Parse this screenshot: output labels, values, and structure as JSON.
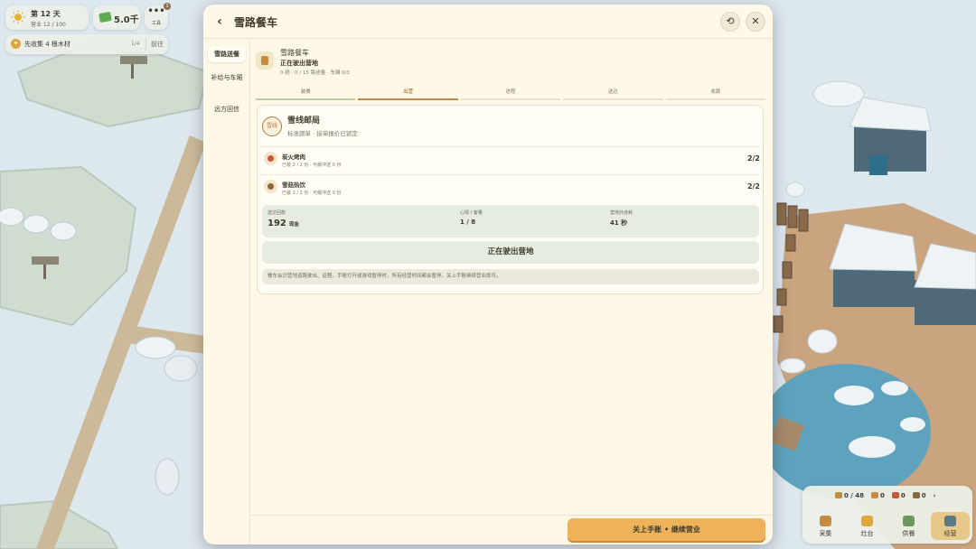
{
  "hud": {
    "day_label": "第 12 天",
    "time_label": "营业 12 / 100",
    "money": "5.0千",
    "tools_label": "工具",
    "tools_badge": "3",
    "tools_dots": "•••",
    "quest_text": "先收集 4 根木材",
    "quest_progress": "1/4",
    "quest_go": "前往"
  },
  "modal": {
    "title": "雪路餐车",
    "back_icon": "‹",
    "refresh_icon": "⟲",
    "close_icon": "✕",
    "sidebar": [
      {
        "label": "雪路送餐",
        "active": true
      },
      {
        "label": "补给与车厢",
        "active": false
      },
      {
        "label": "远方回信",
        "active": false
      }
    ],
    "info": {
      "name": "雪路餐车",
      "status": "正在驶出营地",
      "stats": "0 趟 · 0 / 15 路途量 · 车厢 0/3"
    },
    "steps": [
      {
        "label": "装餐",
        "state": "done"
      },
      {
        "label": "出营",
        "state": "active"
      },
      {
        "label": "途程",
        "state": "todo"
      },
      {
        "label": "送达",
        "state": "todo"
      },
      {
        "label": "收款",
        "state": "todo"
      }
    ],
    "card": {
      "stamp": "雪线",
      "title": "雪线邮局",
      "subtitle": "标准跟单 · 接单报价已锁定",
      "dishes": [
        {
          "name": "炭火烤肉",
          "sub": "已装 2 / 2 份 · 可缓冲送 0 份",
          "count": "2/2",
          "color": "#c9573a"
        },
        {
          "name": "雪菇热饮",
          "sub": "已装 2 / 2 份 · 可缓冲送 0 份",
          "count": "2/2",
          "color": "#8a6a3a"
        }
      ],
      "stats": [
        {
          "label": "送达回款",
          "value": "192",
          "unit": "现金"
        },
        {
          "label": "心情 / 客量",
          "value": "1 / 8",
          "unit": ""
        },
        {
          "label": "营地外途耗",
          "value": "41 秒",
          "unit": ""
        }
      ],
      "status_text": "正在驶出营地",
      "note": "餐车会识营地道路驶出、返程。手账打开或游戏暂停时，所有经营时间都会暂停，关上手账继续营业即可。"
    },
    "continue_label": "关上手账 • 继续营业"
  },
  "bottom_hud": {
    "resources": [
      "0 / 48",
      "0",
      "0",
      "0"
    ],
    "resource_colors": [
      "#c58a3c",
      "#c98a44",
      "#c9573a",
      "#8a6a3a"
    ],
    "more": "›",
    "tabs": [
      {
        "label": "采集",
        "color": "#c98a44",
        "active": false
      },
      {
        "label": "灶台",
        "color": "#e0a83c",
        "active": false
      },
      {
        "label": "供餐",
        "color": "#6a9a5a",
        "active": false
      },
      {
        "label": "经营",
        "color": "#5a7a8a",
        "active": true
      }
    ]
  }
}
